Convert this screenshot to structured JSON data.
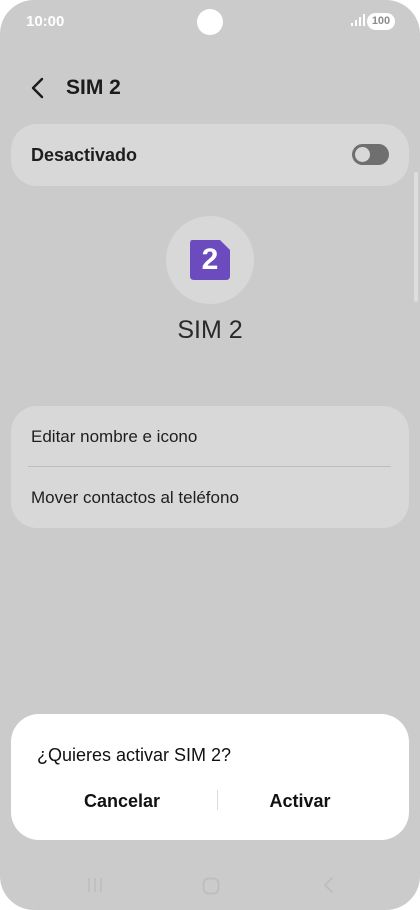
{
  "status_bar": {
    "time": "10:00",
    "battery": "100",
    "icons": [
      "camera-hole",
      "signal-icon",
      "battery-icon"
    ]
  },
  "header": {
    "back_icon": "chevron-left-icon",
    "title": "SIM 2"
  },
  "toggle": {
    "label": "Desactivado",
    "state": "off"
  },
  "sim": {
    "icon": "sim-card-icon",
    "number": "2",
    "name": "SIM 2",
    "icon_color": "#6b4bbd"
  },
  "menu": {
    "items": [
      {
        "label": "Editar nombre e icono"
      },
      {
        "label": "Mover contactos al teléfono"
      }
    ]
  },
  "dialog": {
    "title": "¿Quieres activar SIM 2?",
    "cancel_label": "Cancelar",
    "activate_label": "Activar"
  },
  "nav_bar": {
    "icons": [
      "recent-apps-icon",
      "home-icon",
      "back-icon"
    ]
  },
  "colors": {
    "background_dimmed": "#cbcbcb",
    "card": "#d8d8d8",
    "dialog": "#ffffff",
    "sim_accent": "#6b4bbd"
  }
}
